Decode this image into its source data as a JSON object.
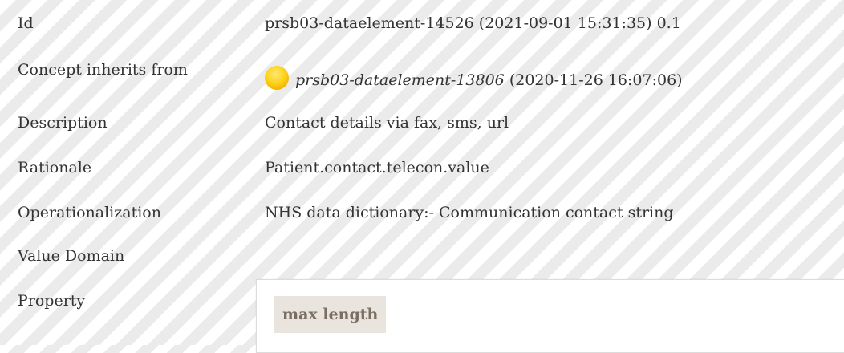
{
  "rows": [
    {
      "label": "Id",
      "value": "prsb03-dataelement-14526 (2021-09-01 15:31:35) 0.1"
    },
    {
      "label": "Concept inherits from",
      "link": "prsb03-dataelement-13806",
      "suffix": "(2020-11-26 16:07:06)"
    },
    {
      "label": "Description",
      "value": "Contact details via fax, sms, url"
    },
    {
      "label": "Rationale",
      "value": "Patient.contact.telecon.value"
    },
    {
      "label": "Operationalization",
      "value": "NHS data dictionary:- Communication contact string"
    },
    {
      "label": "Value Domain",
      "value": ""
    },
    {
      "label": "Property",
      "value": ""
    }
  ],
  "property_panel": {
    "tag": "max length"
  },
  "icons": {
    "inherit": "inherit-status-icon"
  },
  "colors": {
    "stripe_light": "#ffffff",
    "stripe_dark": "#ebebeb",
    "tag_bg": "#e9e4dd",
    "tag_text": "#7a6e62"
  }
}
